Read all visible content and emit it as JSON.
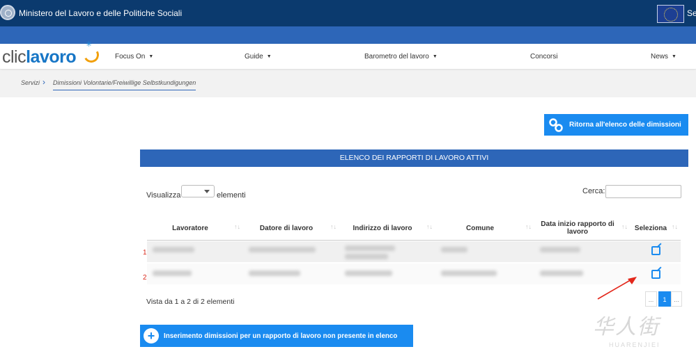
{
  "header": {
    "ministry": "Ministero del Lavoro e delle Politiche Sociali",
    "right_cut": "Seg"
  },
  "nav": {
    "logo_clic": "clic",
    "logo_lavoro": "lavoro",
    "items": [
      {
        "label": "Focus On",
        "dropdown": true
      },
      {
        "label": "Guide",
        "dropdown": true
      },
      {
        "label": "Barometro del lavoro",
        "dropdown": true
      },
      {
        "label": "Concorsi",
        "dropdown": false
      },
      {
        "label": "News",
        "dropdown": true
      }
    ]
  },
  "breadcrumb": {
    "items": [
      "Servizi",
      "Dimissioni Volontarie/Freiwillige Selbstkundigungen"
    ]
  },
  "actions": {
    "return_label": "Ritorna all'elenco delle dimissioni",
    "insert_label": "Inserimento dimissioni per un rapporto di lavoro non presente in elenco"
  },
  "table": {
    "title": "ELENCO DEI RAPPORTI DI LAVORO ATTIVI",
    "show_prefix": "Visualizza",
    "show_suffix": "elementi",
    "search_label": "Cerca:",
    "search_value": "",
    "columns": [
      "Lavoratore",
      "Datore di lavoro",
      "Indirizzo di lavoro",
      "Comune",
      "Data inizio rapporto di lavoro",
      "Seleziona"
    ],
    "row_numbers": [
      "1",
      "2"
    ],
    "info": "Vista da 1 a 2 di 2 elementi",
    "pagination": {
      "prev": "...",
      "current": "1",
      "next": "..."
    }
  },
  "icons": {
    "select": "external-link-icon",
    "return": "link-icon",
    "insert": "plus-circle-icon",
    "annotation": "red-arrow"
  },
  "colors": {
    "topbar": "#0b3a6e",
    "primary": "#2d66b8",
    "button": "#1a8bf0",
    "annotation": "#d9281b"
  },
  "watermark": {
    "cjk": "华人街",
    "latin": "HUARENJIEI"
  }
}
